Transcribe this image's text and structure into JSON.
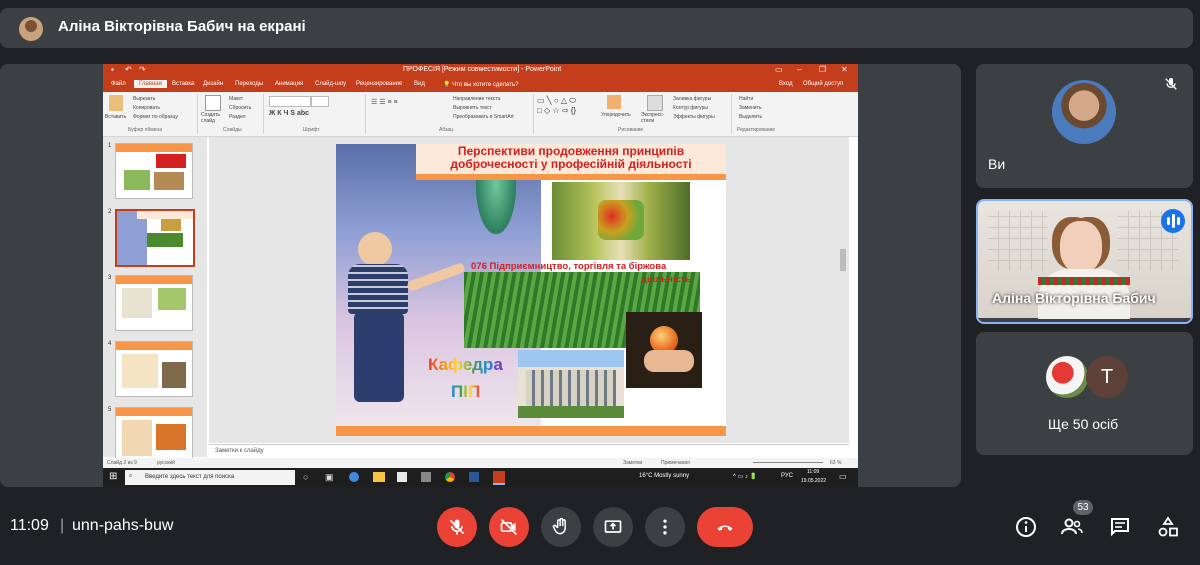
{
  "banner": {
    "presenter_text": "Аліна Вікторівна Бабич на екрані"
  },
  "powerpoint": {
    "title": "ПРОФЕСІЯ [Режим совместимости] - PowerPoint",
    "tabs": [
      "Файл",
      "Главная",
      "Вставка",
      "Дизайн",
      "Переходы",
      "Анимация",
      "Слайд-шоу",
      "Рецензирование",
      "Вид"
    ],
    "tell_me": "Что вы хотите сделать?",
    "sign_in": "Вход",
    "share": "Общий доступ",
    "ribbon": {
      "paste": "Вставить",
      "cut": "Вырезать",
      "copy": "Копировать",
      "format_painter": "Формат по образцу",
      "new_slide": "Создать слайд",
      "layout": "Макет",
      "reset": "Сбросить",
      "section": "Раздел",
      "text_direction": "Направление текста",
      "align_text": "Выровнять текст",
      "smartart": "Преобразовать в SmartArt",
      "arrange": "Упорядочить",
      "quick_styles": "Экспресс-стили",
      "shape_fill": "Заливка фигуры",
      "shape_outline": "Контур фигуры",
      "shape_effects": "Эффекты фигуры",
      "find": "Найти",
      "replace": "Заменить",
      "select": "Выделить",
      "groups": [
        "Буфер обмена",
        "Слайды",
        "Шрифт",
        "Абзац",
        "Рисование",
        "Редактирование"
      ]
    },
    "thumb_numbers": [
      "1",
      "2",
      "3",
      "4",
      "5"
    ],
    "notes_placeholder": "Заметки к слайду",
    "status": {
      "slide": "Слайд 2 из 9",
      "lang": "русский",
      "notes": "Заметки",
      "comments": "Примечания",
      "zoom": "63 %"
    },
    "taskbar": {
      "search": "Введите здесь текст для поиска",
      "weather": "16°C  Mostly sunny",
      "lang": "РУС",
      "time": "11:09",
      "date": "19.05.2022"
    },
    "slide": {
      "title": "Перспективи продовження принципів доброчесності у професійній діяльності",
      "subtitle_line1": "076 Підприємництво, торгівля та біржова",
      "subtitle_line2": "діяльність",
      "kafedra": "Кафедра",
      "pip": "ПІП"
    }
  },
  "participants": {
    "self_label": "Ви",
    "speaker_name": "Аліна Вікторівна Бабич",
    "others_label": "Ще 50 осіб",
    "others_avatar_letter": "T"
  },
  "bottom": {
    "time": "11:09",
    "divider": "|",
    "meeting_code": "unn-pahs-buw",
    "people_count": "53"
  },
  "colors": {
    "end_call": "#ea4335",
    "muted": "#ea4335",
    "speaking_border": "#8ab4f8",
    "ppt_brand": "#c43e1c"
  }
}
